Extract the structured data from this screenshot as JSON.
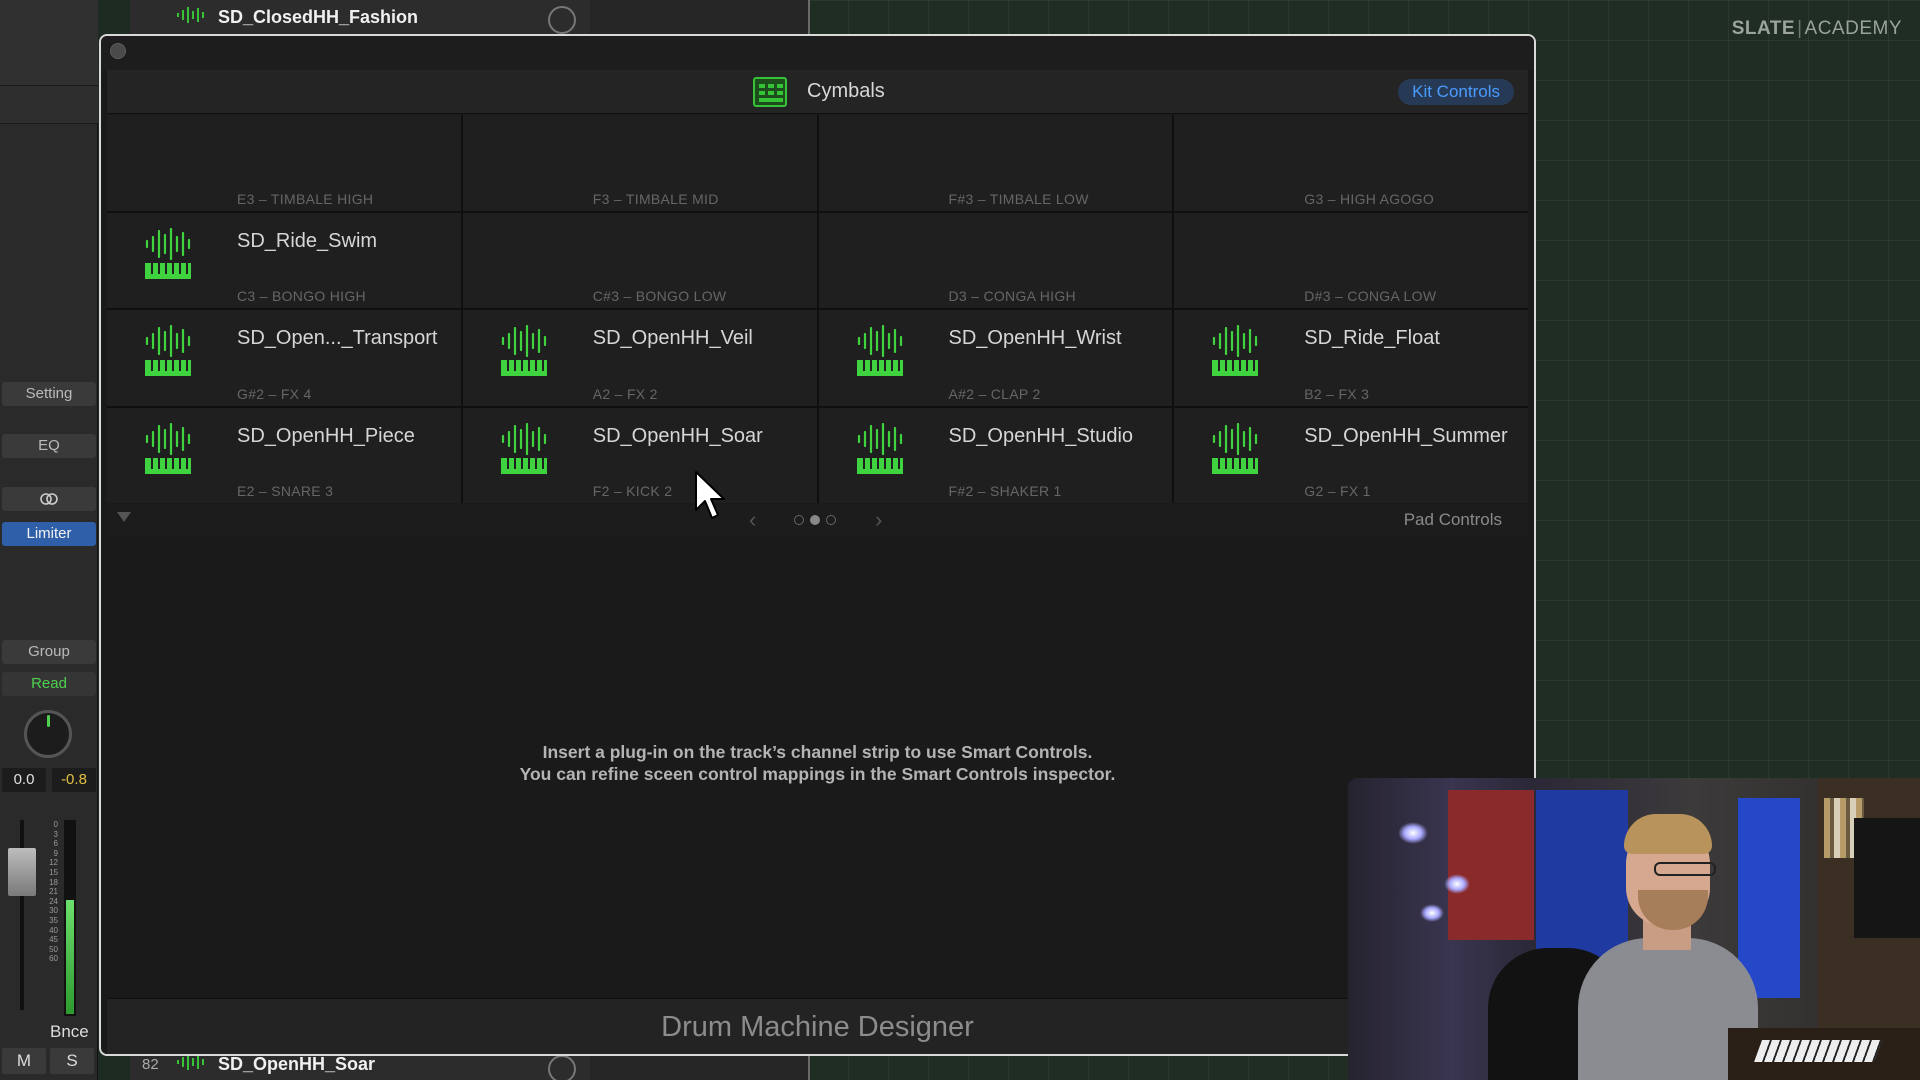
{
  "background": {
    "top_track": {
      "name": "SD_ClosedHH_Fashion"
    },
    "bottom_track": {
      "number": "82",
      "name": "SD_OpenHH_Soar"
    },
    "brand": {
      "part1": "SLATE",
      "separator": "|",
      "part2": "ACADEMY"
    }
  },
  "channel_strip": {
    "setting_label": "Setting",
    "eq_label": "EQ",
    "link_icon": "link-icon",
    "limiter_label": "Limiter",
    "group_label": "Group",
    "automation_label": "Read",
    "volume_value": "0.0",
    "peak_value": "-0.8",
    "meter_scale": [
      "0",
      "3",
      "6",
      "9",
      "12",
      "15",
      "18",
      "21",
      "24",
      "30",
      "35",
      "40",
      "45",
      "50",
      "60"
    ],
    "output_label": "Bnce",
    "mute_label": "M",
    "solo_label": "S",
    "colors": {
      "limiter": "#2f5fa8",
      "read": "#4ed24e",
      "peak": "#e0c040"
    }
  },
  "window": {
    "kit_name": "Cymbals",
    "kit_controls_label": "Kit Controls",
    "pads": [
      {
        "name": "",
        "note": "E3 – TIMBALE HIGH",
        "has_sample": false
      },
      {
        "name": "",
        "note": "F3 – TIMBALE MID",
        "has_sample": false
      },
      {
        "name": "",
        "note": "F#3 – TIMBALE LOW",
        "has_sample": false
      },
      {
        "name": "",
        "note": "G3 – HIGH AGOGO",
        "has_sample": false
      },
      {
        "name": "SD_Ride_Swim",
        "note": "C3 – BONGO HIGH",
        "has_sample": true
      },
      {
        "name": "",
        "note": "C#3 – BONGO LOW",
        "has_sample": false
      },
      {
        "name": "",
        "note": "D3 – CONGA HIGH",
        "has_sample": false
      },
      {
        "name": "",
        "note": "D#3 – CONGA LOW",
        "has_sample": false
      },
      {
        "name": "SD_Open..._Transport",
        "note": "G#2 – FX 4",
        "has_sample": true
      },
      {
        "name": "SD_OpenHH_Veil",
        "note": "A2 – FX 2",
        "has_sample": true
      },
      {
        "name": "SD_OpenHH_Wrist",
        "note": "A#2 – CLAP 2",
        "has_sample": true
      },
      {
        "name": "SD_Ride_Float",
        "note": "B2 – FX 3",
        "has_sample": true
      },
      {
        "name": "SD_OpenHH_Piece",
        "note": "E2 – SNARE 3",
        "has_sample": true
      },
      {
        "name": "SD_OpenHH_Soar",
        "note": "F2 – KICK 2",
        "has_sample": true
      },
      {
        "name": "SD_OpenHH_Studio",
        "note": "F#2 – SHAKER 1",
        "has_sample": true
      },
      {
        "name": "SD_OpenHH_Summer",
        "note": "G2 – FX 1",
        "has_sample": true
      }
    ],
    "pager": {
      "prev": "‹",
      "next": "›",
      "pages": 3,
      "current_page": 2
    },
    "pad_controls_label": "Pad Controls",
    "smart_controls_message": [
      "Insert a plug-in on the track’s channel strip to use Smart Controls.",
      "You can refine sceen control mappings in the Smart Controls inspector."
    ],
    "footer_title": "Drum Machine Designer",
    "colors": {
      "accent_green": "#36c436",
      "kit_controls_text": "#4a9bff"
    }
  }
}
